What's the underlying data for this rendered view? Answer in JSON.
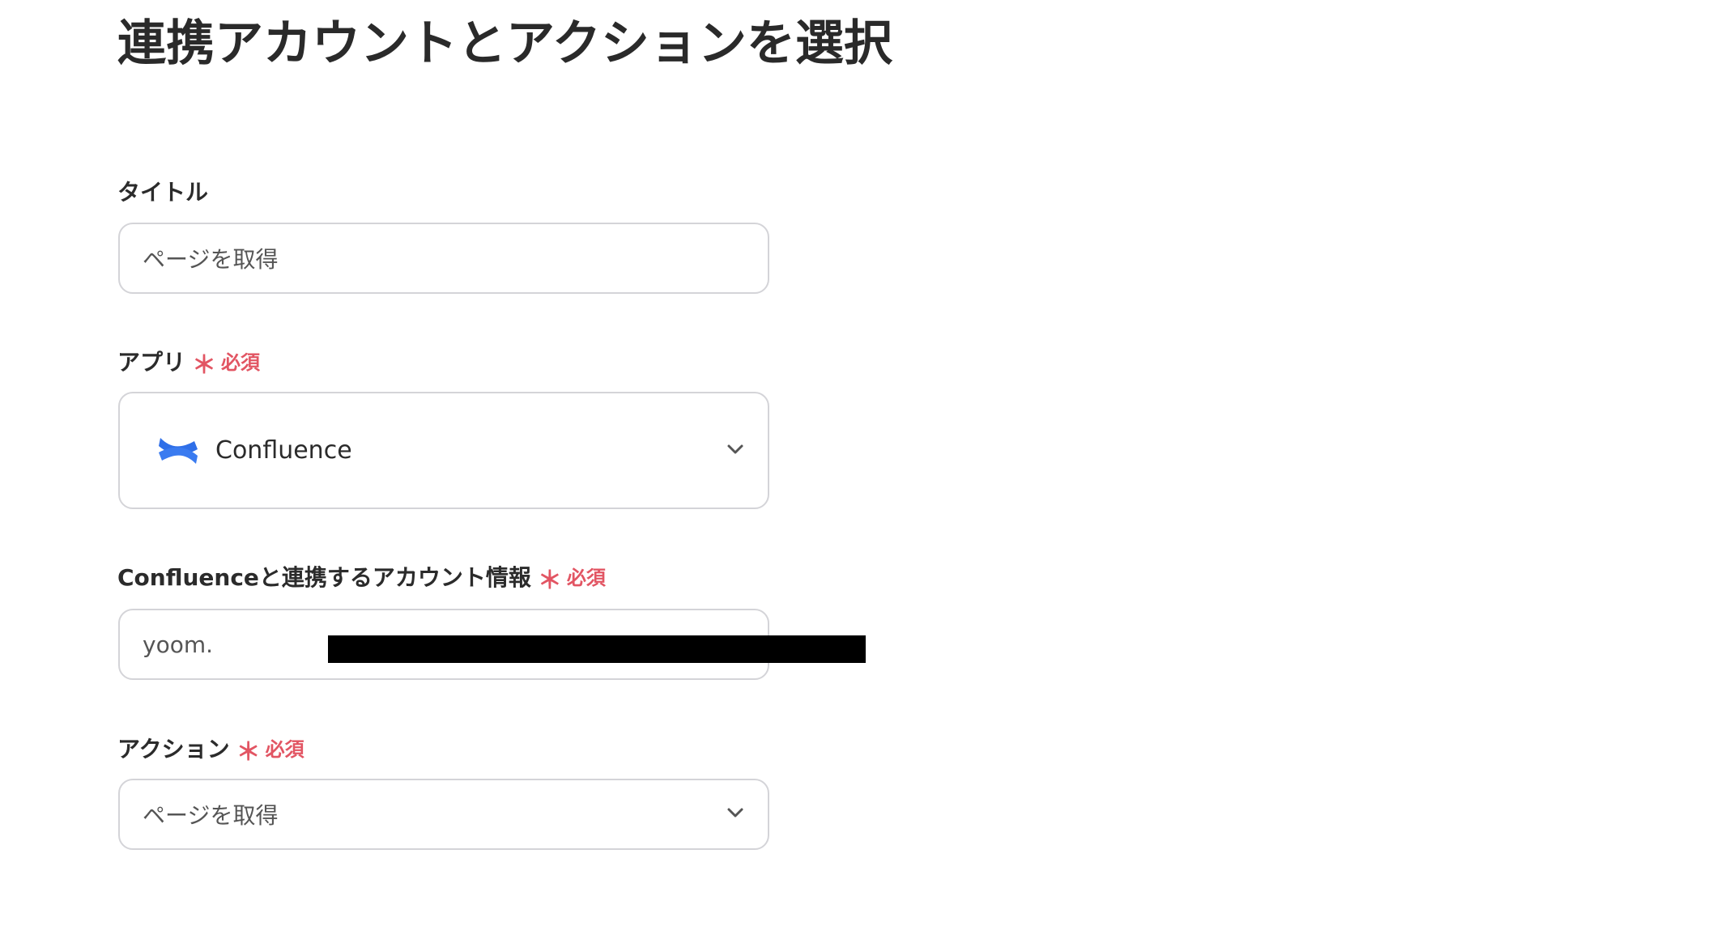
{
  "page_title": "連携アカウントとアクションを選択",
  "fields": {
    "title": {
      "label": "タイトル",
      "value": "ページを取得"
    },
    "app": {
      "label": "アプリ",
      "required_mark": "＊",
      "required_text": "必須",
      "value": "Confluence",
      "icon": "confluence-logo"
    },
    "account": {
      "label": "Confluenceと連携するアカウント情報",
      "required_mark": "＊",
      "required_text": "必須",
      "value": "yoom."
    },
    "action": {
      "label": "アクション",
      "required_mark": "＊",
      "required_text": "必須",
      "value": "ページを取得"
    }
  },
  "colors": {
    "required": "#e25563",
    "border": "#d4d4d8",
    "confluence_blue": "#2f6fe8"
  }
}
